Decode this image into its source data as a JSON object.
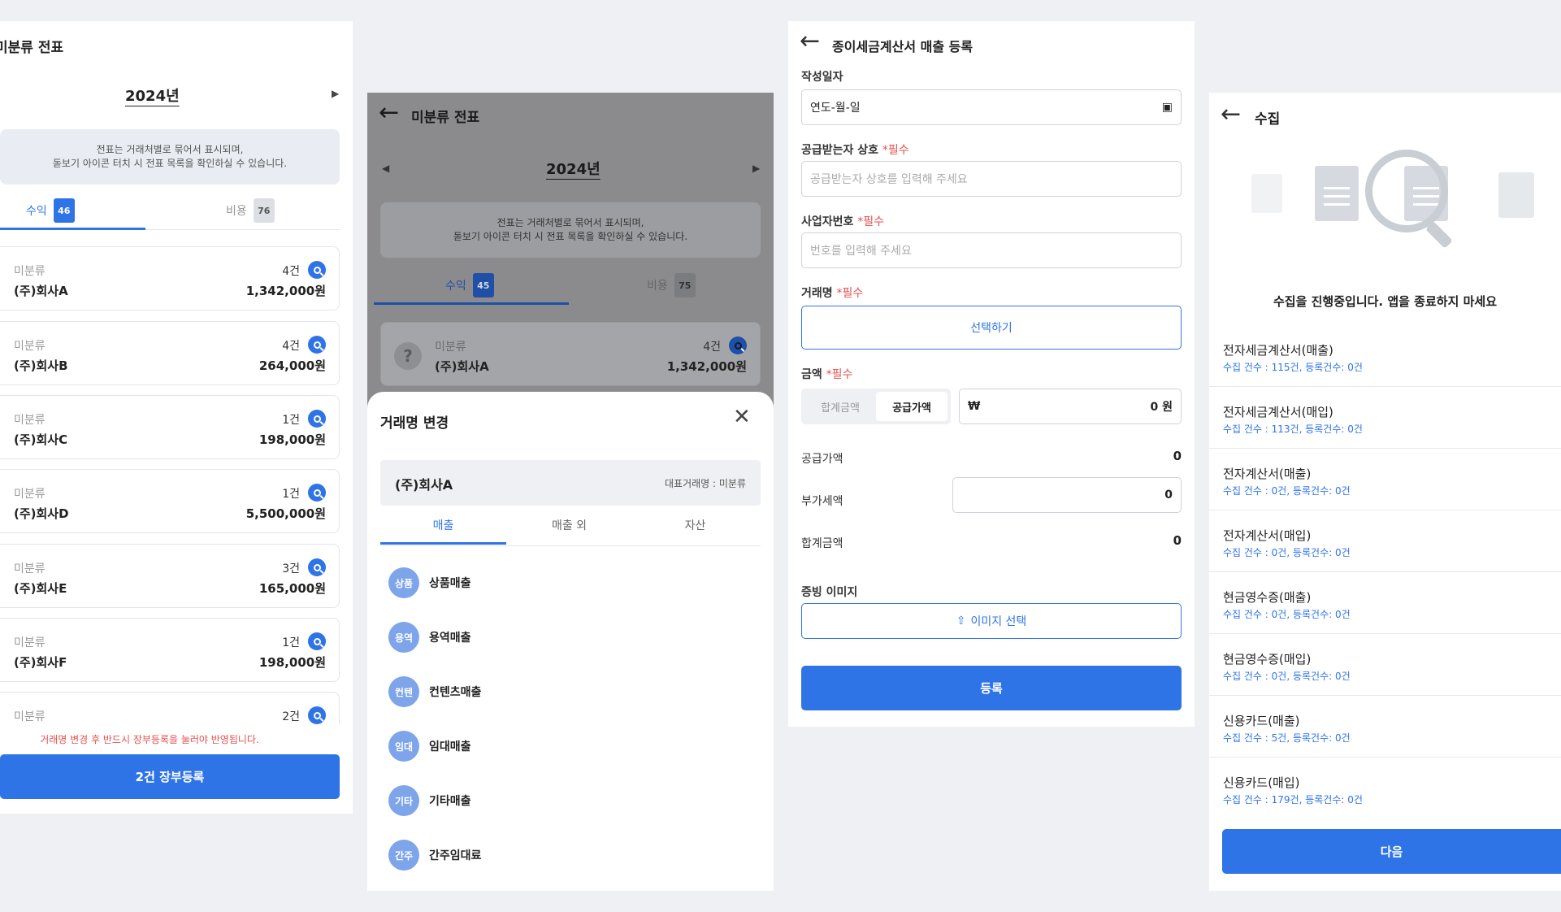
{
  "colors": {
    "accent": "#2f74e6",
    "warning": "#e55050",
    "background": "#eef0f3",
    "dim_overlay": "#8b8b8d"
  },
  "panel1": {
    "title": "미분류 전표",
    "year": "2024년",
    "notice_line1": "전표는 거래처별로 묶어서 표시되며,",
    "notice_line2": "돋보기 아이콘 터치 시 전표 목록을 확인하실 수 있습니다.",
    "tabs": [
      {
        "label": "수익",
        "count": "46"
      },
      {
        "label": "비용",
        "count": "76"
      }
    ],
    "cards": [
      {
        "category": "미분류",
        "company": "(주)회사A",
        "count": "4건",
        "amount": "1,342,000원"
      },
      {
        "category": "미분류",
        "company": "(주)회사B",
        "count": "4건",
        "amount": "264,000원"
      },
      {
        "category": "미분류",
        "company": "(주)회사C",
        "count": "1건",
        "amount": "198,000원"
      },
      {
        "category": "미분류",
        "company": "(주)회사D",
        "count": "1건",
        "amount": "5,500,000원"
      },
      {
        "category": "미분류",
        "company": "(주)회사E",
        "count": "3건",
        "amount": "165,000원"
      },
      {
        "category": "미분류",
        "company": "(주)회사F",
        "count": "1건",
        "amount": "198,000원"
      },
      {
        "category": "미분류",
        "company": "",
        "count": "2건",
        "amount": ""
      }
    ],
    "warning": "거래명 변경 후 반드시 장부등록을 눌러야 반영됩니다.",
    "register_button": "2건 장부등록"
  },
  "panel2": {
    "title": "미분류 전표",
    "year": "2024년",
    "notice_line1": "전표는 거래처별로 묶어서 표시되며,",
    "notice_line2": "돋보기 아이콘 터치 시 전표 목록을 확인하실 수 있습니다.",
    "tabs": [
      {
        "label": "수익",
        "count": "45"
      },
      {
        "label": "비용",
        "count": "75"
      }
    ],
    "card": {
      "mark": "?",
      "category": "미분류",
      "company": "(주)회사A",
      "count": "4건",
      "amount": "1,342,000원"
    },
    "sheet": {
      "title": "거래명 변경",
      "company": "(주)회사A",
      "rep_label": "대표거래명 : 미분류",
      "tabs": [
        "매출",
        "매출 외",
        "자산"
      ],
      "items": [
        {
          "short": "상품",
          "label": "상품매출"
        },
        {
          "short": "용역",
          "label": "용역매출"
        },
        {
          "short": "컨텐",
          "label": "컨텐츠매출"
        },
        {
          "short": "임대",
          "label": "임대매출"
        },
        {
          "short": "기타",
          "label": "기타매출"
        },
        {
          "short": "간주",
          "label": "간주임대료"
        }
      ]
    }
  },
  "panel3": {
    "title": "종이세금계산서 매출 등록",
    "date_label": "작성일자",
    "date_value": "연도-월-일",
    "buyer_label": "공급받는자 상호",
    "required": "*필수",
    "buyer_placeholder": "공급받는자 상호를 입력해 주세요",
    "bizno_label": "사업자번호",
    "bizno_placeholder": "번호를 입력해 주세요",
    "trade_label": "거래명",
    "select_button": "선택하기",
    "amount_label": "금액",
    "seg_total": "합계금액",
    "seg_supply": "공급가액",
    "currency": "₩",
    "amount_value": "0 원",
    "supply_label": "공급가액",
    "supply_value": "0",
    "vat_label": "부가세액",
    "vat_value": "0",
    "total_label": "합계금액",
    "total_value": "0",
    "evidence_label": "증빙 이미지",
    "image_button": "이미지 선택",
    "submit": "등록"
  },
  "panel4": {
    "title": "수집",
    "progress_text": "수집을 진행중입니다. 앱을 종료하지 마세요",
    "items": [
      {
        "title": "전자세금계산서(매출)",
        "detail": "수집 건수 : 115건, 등록건수: 0건"
      },
      {
        "title": "전자세금계산서(매입)",
        "detail": "수집 건수 : 113건, 등록건수: 0건"
      },
      {
        "title": "전자계산서(매출)",
        "detail": "수집 건수 : 0건, 등록건수: 0건"
      },
      {
        "title": "전자계산서(매입)",
        "detail": "수집 건수 : 0건, 등록건수: 0건"
      },
      {
        "title": "현금영수증(매출)",
        "detail": "수집 건수 : 0건, 등록건수: 0건"
      },
      {
        "title": "현금영수증(매입)",
        "detail": "수집 건수 : 0건, 등록건수: 0건"
      },
      {
        "title": "신용카드(매출)",
        "detail": "수집 건수 : 5건, 등록건수: 0건"
      },
      {
        "title": "신용카드(매입)",
        "detail": "수집 건수 : 179건, 등록건수: 0건"
      }
    ],
    "next_button": "다음"
  }
}
